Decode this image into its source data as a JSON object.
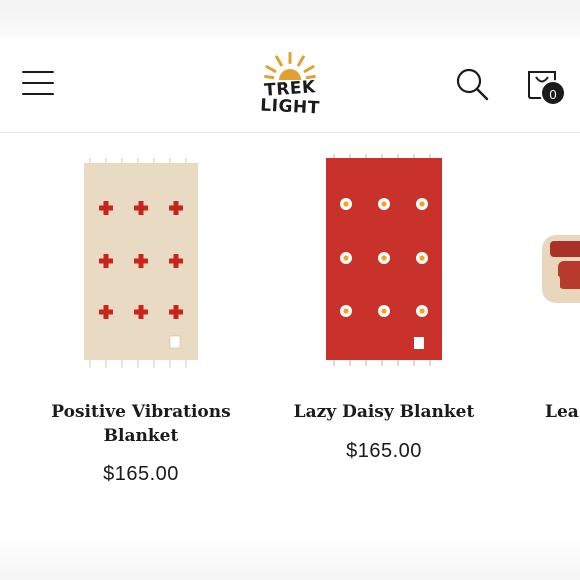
{
  "brand": {
    "line1": "TREK",
    "line2": "LIGHT",
    "colors": {
      "sun": "#e0a032",
      "ink": "#1b1b1b"
    }
  },
  "header": {
    "cart_count": "0",
    "icons": [
      "menu-icon",
      "search-icon",
      "cart-icon"
    ]
  },
  "products": [
    {
      "title_line1": "Positive Vibrations",
      "title_line2": "Blanket",
      "price": "$165.00",
      "color": "#e9dbc3",
      "pattern": "red-crosses"
    },
    {
      "title_line1": "Lazy Daisy Blanket",
      "price": "$165.00",
      "color": "#c8322a",
      "pattern": "white-daisies"
    },
    {
      "title_line1": "Lea",
      "color": "#a83228",
      "pattern": "rolled-blanket"
    }
  ]
}
